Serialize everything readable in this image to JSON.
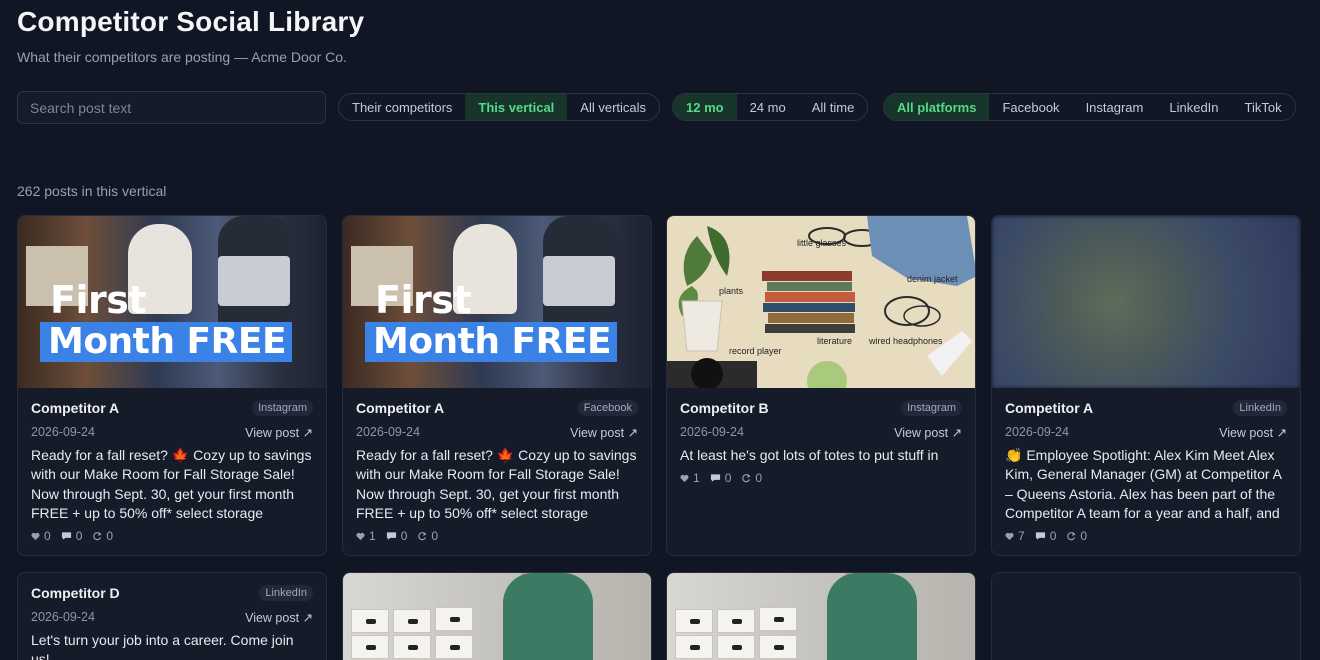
{
  "header": {
    "title": "Competitor Social Library",
    "subtitle": "What their competitors are posting — Acme Door Co."
  },
  "search": {
    "placeholder": "Search post text",
    "value": ""
  },
  "filters": {
    "scope": {
      "options": [
        "Their competitors",
        "This vertical",
        "All verticals"
      ],
      "active": "This vertical"
    },
    "range": {
      "options": [
        "12 mo",
        "24 mo",
        "All time"
      ],
      "active": "12 mo"
    },
    "platform": {
      "options": [
        "All platforms",
        "Facebook",
        "Instagram",
        "LinkedIn",
        "TikTok"
      ],
      "active": "All platforms"
    }
  },
  "results_count": "262 posts in this vertical",
  "colors": {
    "accent": "#56d88a",
    "active_bg": "#17352a",
    "background": "#111624",
    "card": "#161b29",
    "promo_blue": "#3b82e6"
  },
  "promo_text": {
    "line1": "First",
    "line2": "Month FREE"
  },
  "collage_labels": [
    "little glasses",
    "denim jacket",
    "plants",
    "record player",
    "literature",
    "wired headphones"
  ],
  "view_label": "View post ↗",
  "posts": [
    {
      "competitor": "Competitor A",
      "platform": "Instagram",
      "date": "2026-09-24",
      "text": "Ready for a fall reset? 🍁 Cozy up to savings with our Make Room for Fall Storage Sale! Now through Sept. 30, get your first month FREE + up to 50% off* select storage",
      "likes": "0",
      "comments": "0",
      "shares": "0"
    },
    {
      "competitor": "Competitor A",
      "platform": "Facebook",
      "date": "2026-09-24",
      "text": "Ready for a fall reset? 🍁 Cozy up to savings with our Make Room for Fall Storage Sale! Now through Sept. 30, get your first month FREE + up to 50% off* select storage",
      "likes": "1",
      "comments": "0",
      "shares": "0"
    },
    {
      "competitor": "Competitor B",
      "platform": "Instagram",
      "date": "2026-09-24",
      "text": "At least he's got lots of totes to put stuff in",
      "likes": "1",
      "comments": "0",
      "shares": "0"
    },
    {
      "competitor": "Competitor A",
      "platform": "LinkedIn",
      "date": "2026-09-24",
      "text": "👏 Employee Spotlight: Alex Kim Meet Alex Kim, General Manager (GM) at Competitor A – Queens Astoria. Alex has been part of the Competitor A team for a year and a half, and",
      "likes": "7",
      "comments": "0",
      "shares": "0"
    },
    {
      "competitor": "Competitor D",
      "platform": "LinkedIn",
      "date": "2026-09-24",
      "text": "Let's turn your job into a career. Come join us!"
    }
  ]
}
